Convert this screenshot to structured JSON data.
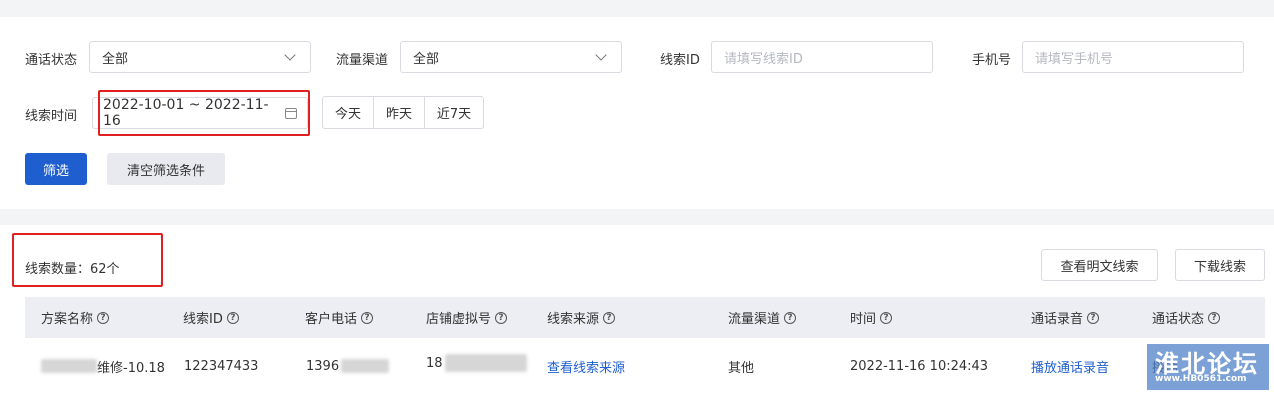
{
  "filters": {
    "call_status": {
      "label": "通话状态",
      "value": "全部"
    },
    "traffic_channel": {
      "label": "流量渠道",
      "value": "全部"
    },
    "lead_id": {
      "label": "线索ID",
      "placeholder": "请填写线索ID"
    },
    "phone": {
      "label": "手机号",
      "placeholder": "请填写手机号"
    },
    "lead_time": {
      "label": "线索时间",
      "value": "2022-10-01 ~ 2022-11-16"
    },
    "quick_ranges": [
      "今天",
      "昨天",
      "近7天"
    ],
    "filter_button": "筛选",
    "clear_button": "清空筛选条件"
  },
  "summary": {
    "count_label": "线索数量：62个"
  },
  "actions": {
    "view_plain": "查看明文线索",
    "download": "下载线索"
  },
  "table": {
    "columns": [
      "方案名称",
      "线索ID",
      "客户电话",
      "店铺虚拟号",
      "线索来源",
      "流量渠道",
      "时间",
      "通话录音",
      "通话状态"
    ],
    "rows": [
      {
        "plan_name": "维修-10.18",
        "lead_id": "122347433",
        "customer_phone": "1396",
        "store_virtual_number": "18",
        "source": "查看线索来源",
        "channel": "其他",
        "time": "2022-11-16 10:24:43",
        "recording": "播放通话录音",
        "status": "接通"
      }
    ]
  },
  "watermark": {
    "title": "淮北论坛",
    "url": "www.HB0561.com"
  },
  "colors": {
    "primary": "#1f5ecf",
    "highlight_box": "#e02020",
    "header_bg": "#eceef3"
  }
}
